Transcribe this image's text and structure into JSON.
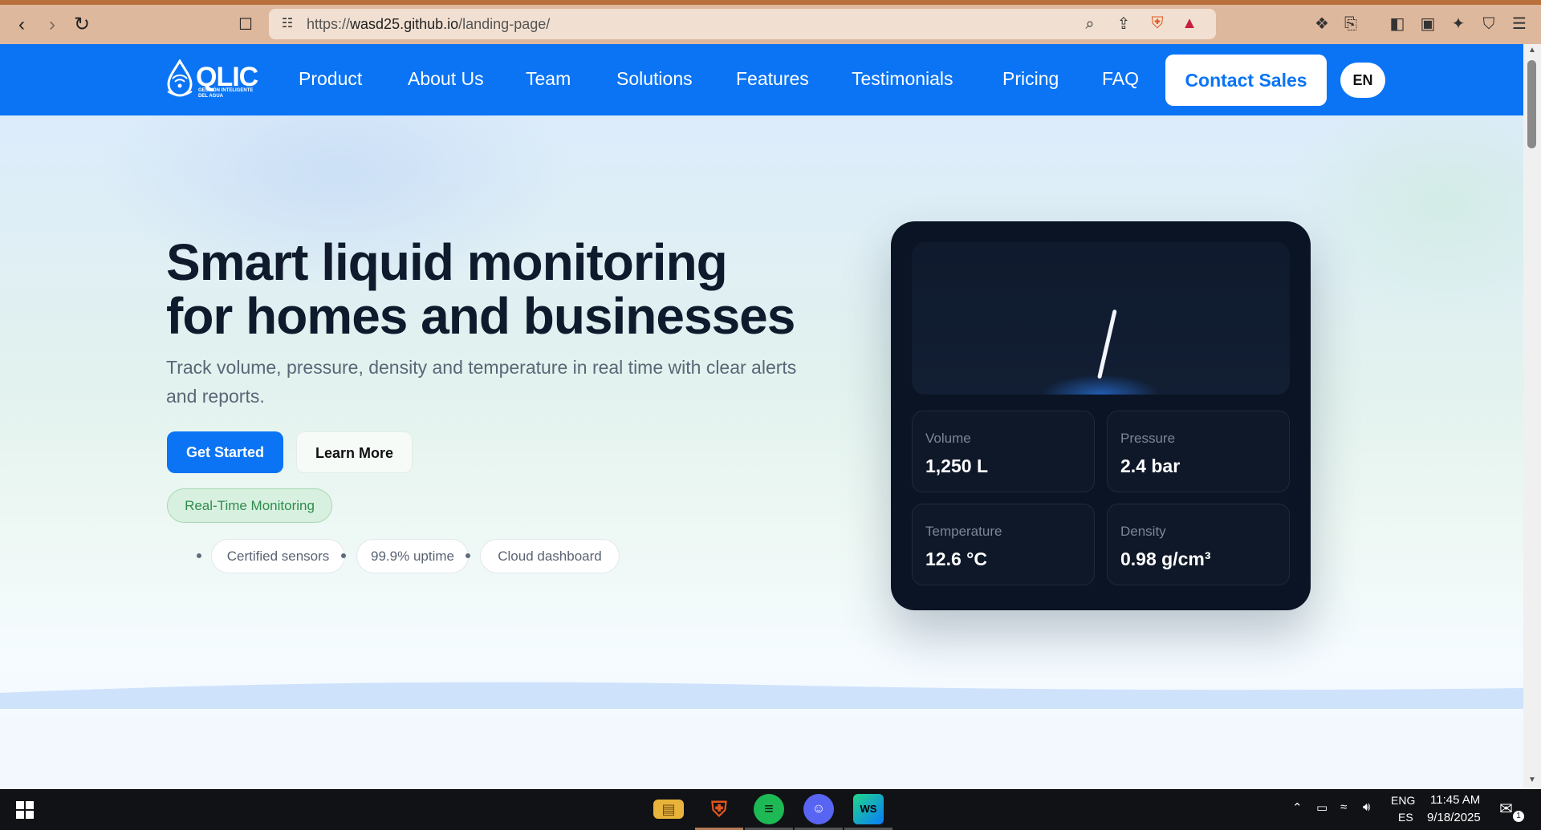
{
  "browser": {
    "url_prefix": "https://",
    "url_domain": "wasd25.github.io",
    "url_path": "/landing-page/",
    "icons": [
      "back-icon",
      "forward-icon",
      "reload-icon",
      "bookmark-icon",
      "site-settings-icon",
      "zoom-icon",
      "share-icon",
      "brave-shields-icon",
      "brave-rewards-icon",
      "extensions-icon",
      "tab-search-icon",
      "sidebar-icon",
      "wallet-icon",
      "leo-ai-icon",
      "vpn-icon",
      "menu-icon"
    ]
  },
  "site": {
    "logo": {
      "name": "QLIC",
      "tagline": "GESTIÓN INTELIGENTE DEL AGUA"
    },
    "nav": [
      "Product",
      "About Us",
      "Team",
      "Solutions",
      "Features",
      "Testimonials",
      "Pricing",
      "FAQ"
    ],
    "contact_label": "Contact Sales",
    "language": "EN"
  },
  "hero": {
    "title_line1": "Smart liquid monitoring",
    "title_line2": "for homes and businesses",
    "subtitle": "Track volume, pressure, density and temperature in real time with clear alerts and reports.",
    "primary_button": "Get Started",
    "secondary_button": "Learn More",
    "badge": "Real-Time Monitoring",
    "features": [
      "Certified sensors",
      "99.9% uptime",
      "Cloud dashboard"
    ]
  },
  "dashboard": {
    "metrics": [
      {
        "label": "Volume",
        "value": "1,250 L"
      },
      {
        "label": "Pressure",
        "value": "2.4 bar"
      },
      {
        "label": "Temperature",
        "value": "12.6 °C"
      },
      {
        "label": "Density",
        "value": "0.98 g/cm³"
      }
    ]
  },
  "taskbar": {
    "apps": [
      "file-explorer-icon",
      "brave-icon",
      "spotify-icon",
      "discord-icon",
      "webstorm-icon"
    ],
    "lang_top": "ENG",
    "lang_bottom": "ES",
    "time": "11:45 AM",
    "date": "9/18/2025",
    "notification_count": "1"
  },
  "colors": {
    "accent": "#0a74f5",
    "card": "#0b1424",
    "chrome": "#deb89c"
  }
}
